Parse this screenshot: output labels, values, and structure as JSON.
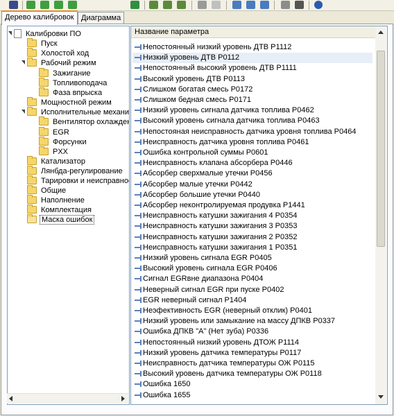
{
  "tabs": [
    {
      "label": "Дерево калибровок"
    },
    {
      "label": "Диаграмма"
    }
  ],
  "toolbar_buttons": [
    "save-icon",
    "add-icon",
    "add-green-icon",
    "add-green-icon",
    "add-green-icon",
    "play-icon",
    "export-icon",
    "export-icon",
    "export-icon",
    "copy-icon",
    "delete-icon",
    "window-icon",
    "window-icon",
    "window-icon",
    "chart-icon",
    "binoculars-icon",
    "info-icon"
  ],
  "tree": {
    "root": "Калибровки ПО",
    "items": [
      {
        "label": "Пуск"
      },
      {
        "label": "Холостой ход"
      },
      {
        "label": "Рабочий режим"
      },
      {
        "label": "Зажигание"
      },
      {
        "label": "Топливоподача"
      },
      {
        "label": "Фаза впрыска"
      },
      {
        "label": "Мощностной режим"
      },
      {
        "label": "Исполнительные механизмы"
      },
      {
        "label": "Вентилятор охлаждения"
      },
      {
        "label": "EGR"
      },
      {
        "label": "Форсунки"
      },
      {
        "label": "PXX"
      },
      {
        "label": "Катализатор"
      },
      {
        "label": "Лянбда-регулирование"
      },
      {
        "label": "Тарировки и неисправности"
      },
      {
        "label": "Общие"
      },
      {
        "label": "Наполнение"
      },
      {
        "label": "Комплектация"
      },
      {
        "label": "Маска ошибок"
      }
    ]
  },
  "list": {
    "header": "Название параметра",
    "rows": [
      "Непостоянный низкий уровень ДТВ P1112",
      "Низкий уровень ДТВ P0112",
      "Непостоянный высокий уровень ДТВ P1111",
      "Высокий уровень ДТВ P0113",
      "Слишком богатая смесь P0172",
      "Слишком бедная смесь P0171",
      "Низкий уровень сигнала датчика топлива P0462",
      "Высокий уровень сигнала датчика топлива P0463",
      "Непостояная неисправность датчика уровня топлива P0464",
      "Неисправность датчика уровня топлива P0461",
      "Ошибка контрольной суммы P0601",
      "Неисправность клапана абсорбера P0446",
      "Абсорбер сверхмалые утечки P0456",
      "Абсорбер малые утечки  P0442",
      "Абсорбер большие утечки P0440",
      "Абсорбер неконтролируемая продувка P1441",
      "Неисправность катушки зажигания 4 P0354",
      "Неисправность катушки зажигания 3 P0353",
      "Неисправность катушки зажигания 2 P0352",
      "Неисправность катушки зажигания 1 P0351",
      " Низкий уровень сигнала EGR P0405",
      "Высокий уровень сигнала EGR P0406",
      "Сигнал EGRвне диапазона P0404",
      "Неверный сигнал EGR при пуске  P0402",
      "EGR неверный сигнал  P1404",
      "Неэфективность EGR (неверный отклик) P0401",
      "Низкий уровень или замыкание на массу ДПКВ P0337",
      "Ошибка ДПКВ \"А\" (Нет зуба) P0336",
      "Непостоянный низкий уровень ДТОЖ P1114",
      "Низкий уровень датчика температуры P0117",
      "Неисправность датчика температуры ОЖ P0115",
      "Высокий уровень датчика температуры ОЖ P0118",
      "Ошибка 1650",
      "Ошибка 1655"
    ]
  }
}
